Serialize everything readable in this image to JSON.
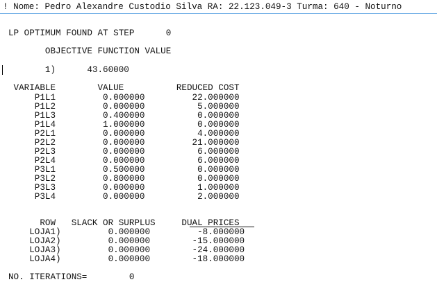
{
  "header": {
    "text": "! Nome: Pedro Alexandre Custodio Silva RA: 22.123.049-3 Turma: 640 - Noturno"
  },
  "solution": {
    "lp_found_line": "LP OPTIMUM FOUND AT STEP      0",
    "objective_heading": "       OBJECTIVE FUNCTION VALUE",
    "objective_value_line": "       1)      43.60000"
  },
  "variables": {
    "header_line": " VARIABLE        VALUE          REDUCED COST",
    "rows": [
      "     P1L1         0.000000         22.000000",
      "     P1L2         0.000000          5.000000",
      "     P1L3         0.400000          0.000000",
      "     P1L4         1.000000          0.000000",
      "     P2L1         0.000000          4.000000",
      "     P2L2         0.000000         21.000000",
      "     P2L3         0.000000          6.000000",
      "     P2L4         0.000000          6.000000",
      "     P3L1         0.500000          0.000000",
      "     P3L2         0.800000          0.000000",
      "     P3L3         0.000000          1.000000",
      "     P3L4         0.000000          2.000000"
    ]
  },
  "constraints": {
    "header_line": "      ROW   SLACK OR SURPLUS     DUAL PRICES",
    "rows": [
      "    LOJA1)         0.000000         -8.000000",
      "    LOJA2)         0.000000        -15.000000",
      "    LOJA3)         0.000000        -24.000000",
      "    LOJA4)         0.000000        -18.000000"
    ]
  },
  "footer": {
    "iterations_line": "NO. ITERATIONS=        0"
  },
  "colors": {
    "background": "#ffffff",
    "text": "#111111",
    "titlebar_border": "#7ab4e8"
  }
}
